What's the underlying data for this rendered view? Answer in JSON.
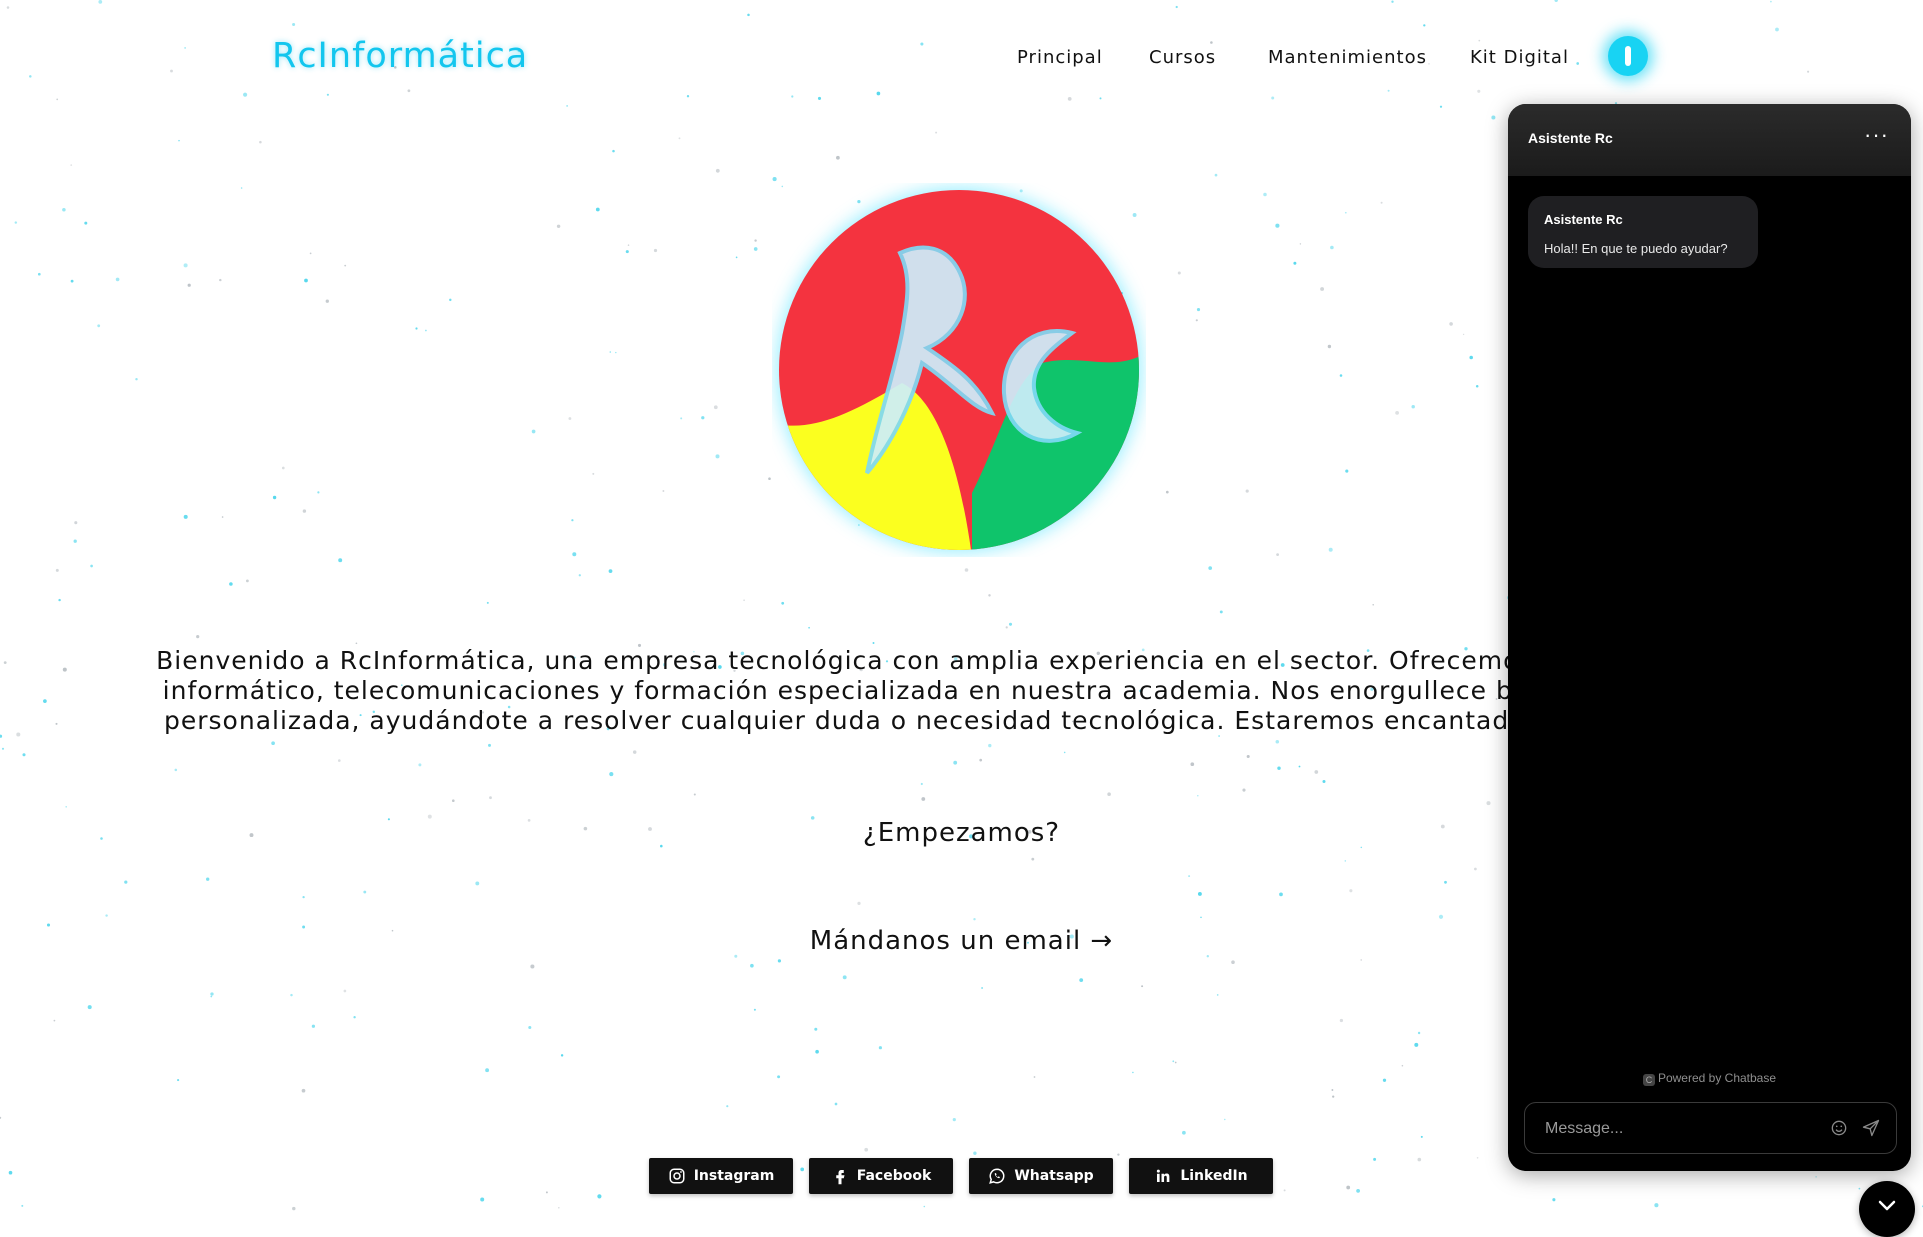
{
  "brand": {
    "name": "RcInformática",
    "color": "#13c6ee"
  },
  "nav": {
    "items": [
      {
        "label": "Principal"
      },
      {
        "label": "Cursos"
      },
      {
        "label": "Mantenimientos"
      },
      {
        "label": "Kit Digital"
      }
    ],
    "theme_toggle_icon": "toggle-icon"
  },
  "hero": {
    "logo_icon": "rc-logo",
    "logo_colors": {
      "red": "#f4333f",
      "yellow": "#fbff1f",
      "green": "#0fc46b",
      "glow": "#3fe0ff"
    },
    "intro_lines": [
      "Bienvenido a RcInformática, una empresa tecnológica con amplia experiencia en el sector. Ofrecemos serv",
      "informático, telecomunicaciones y formación especializada en nuestra academia. Nos enorgullece brindar",
      "personalizada, ayudándote a resolver cualquier duda o necesidad tecnológica. Estaremos encantado"
    ],
    "cta_question": "¿Empezamos?",
    "cta_email": "Mándanos un email →"
  },
  "socials": [
    {
      "label": "Instagram",
      "icon": "instagram-icon"
    },
    {
      "label": "Facebook",
      "icon": "facebook-icon"
    },
    {
      "label": "Whatsapp",
      "icon": "whatsapp-icon"
    },
    {
      "label": "LinkedIn",
      "icon": "linkedin-icon"
    }
  ],
  "chat": {
    "title": "Asistente Rc",
    "more_icon": "more-icon",
    "messages": [
      {
        "author": "Asistente Rc",
        "text": "Hola!! En que te puedo ayudar?"
      }
    ],
    "powered_by": "Powered by Chatbase",
    "input_placeholder": "Message...",
    "emoji_icon": "emoji-icon",
    "send_icon": "send-icon",
    "launcher_icon": "chevron-down-icon"
  }
}
